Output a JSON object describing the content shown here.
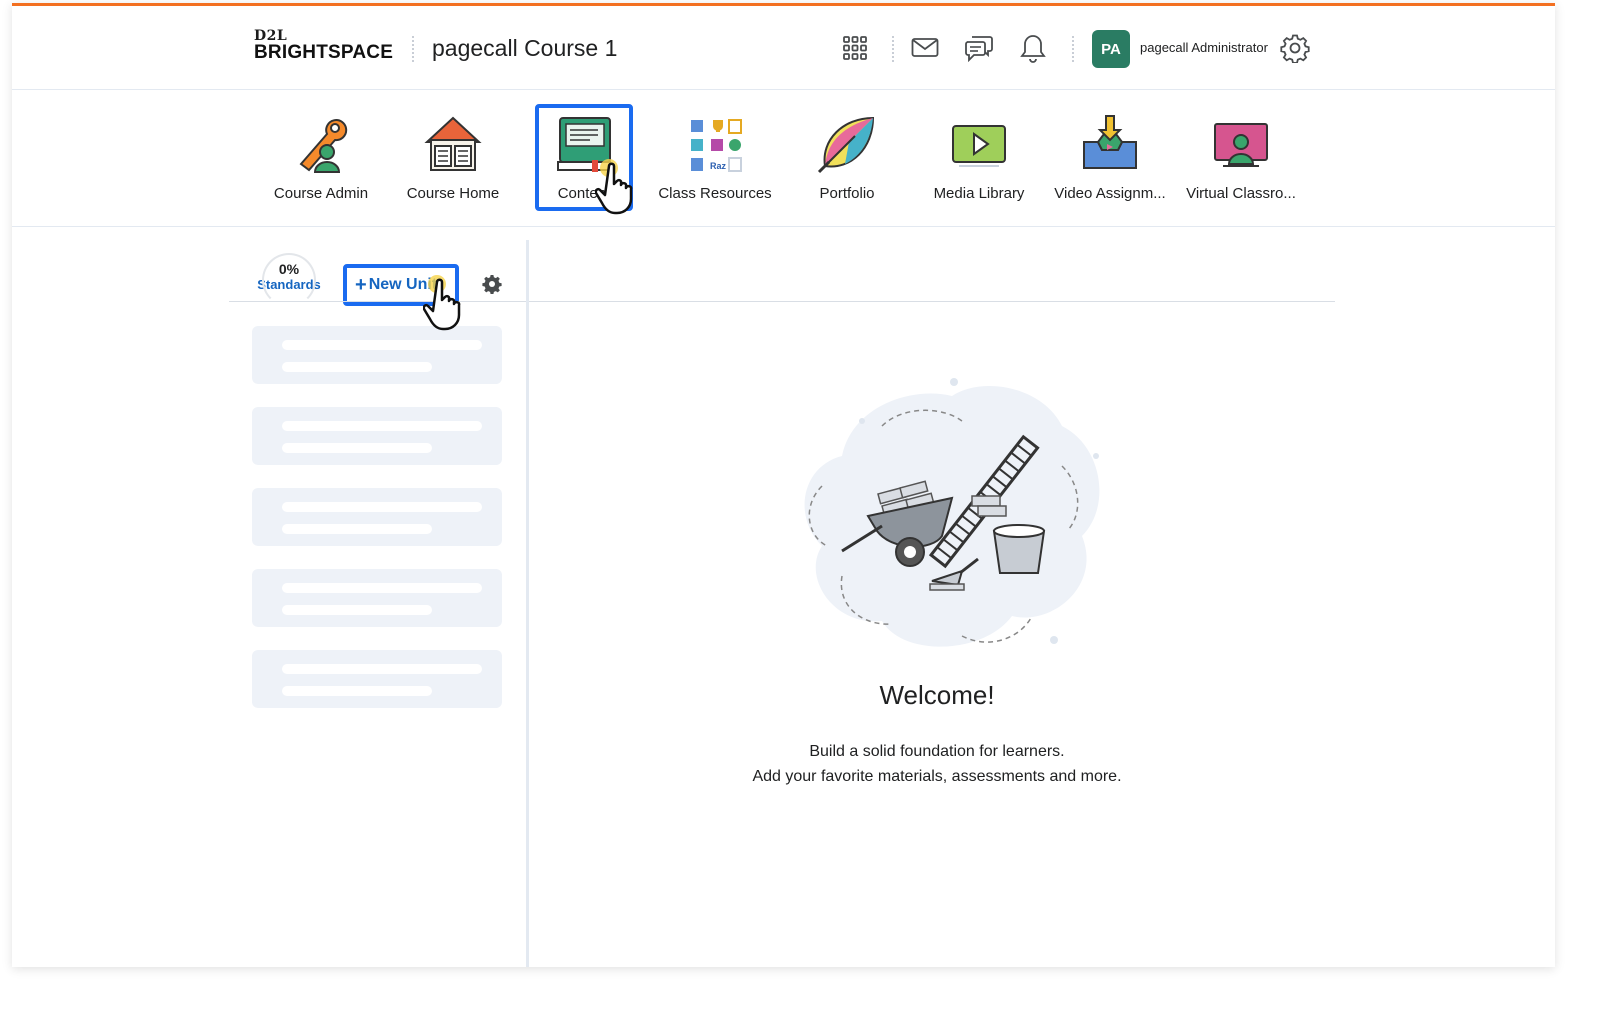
{
  "header": {
    "logo_top": "D2L",
    "logo_bottom": "BRIGHTSPACE",
    "course_title": "pagecall Course 1",
    "icons": [
      "grid-icon",
      "mail-icon",
      "chat-icon",
      "bell-icon",
      "gear-icon"
    ],
    "user": {
      "initials": "PA",
      "name": "pagecall Administrator",
      "avatar_color": "#2a7c63"
    }
  },
  "navbar": {
    "items": [
      {
        "label": "Course Admin",
        "icon": "wrench-person-icon"
      },
      {
        "label": "Course Home",
        "icon": "house-book-icon"
      },
      {
        "label": "Content",
        "icon": "book-screen-icon",
        "highlighted": true
      },
      {
        "label": "Class Resources",
        "icon": "resources-grid-icon"
      },
      {
        "label": "Portfolio",
        "icon": "leaf-icon"
      },
      {
        "label": "Media Library",
        "icon": "play-screen-icon"
      },
      {
        "label": "Video Assignm...",
        "icon": "inbox-download-icon"
      },
      {
        "label": "Virtual Classro...",
        "icon": "presenter-screen-icon"
      }
    ]
  },
  "sidebar": {
    "standards_percent": "0%",
    "standards_label": "Standards",
    "new_unit_label": "New Unit",
    "skeleton_count": 5
  },
  "welcome": {
    "title": "Welcome!",
    "line1": "Build a solid foundation for learners.",
    "line2": "Add your favorite materials, assessments and more."
  },
  "colors": {
    "accent": "#1a6bf0",
    "brand_top": "#f37021",
    "link": "#1565c0"
  }
}
